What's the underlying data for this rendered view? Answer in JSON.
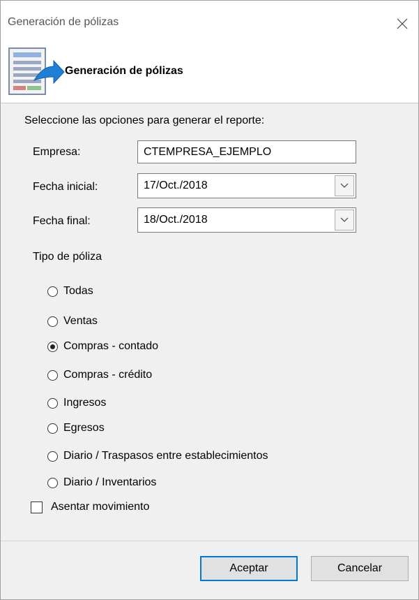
{
  "window": {
    "title": "Generación de pólizas"
  },
  "header": {
    "title": "Generación de pólizas"
  },
  "form": {
    "instructions": "Seleccione las opciones para generar el reporte:",
    "empresa": {
      "label": "Empresa:",
      "value": "CTEMPRESA_EJEMPLO"
    },
    "fecha_inicial": {
      "label": "Fecha inicial:",
      "value": "17/Oct./2018"
    },
    "fecha_final": {
      "label": "Fecha final:",
      "value": "18/Oct./2018"
    },
    "tipo_poliza": {
      "label": "Tipo de póliza",
      "options": [
        "Todas",
        "Ventas",
        "Compras - contado",
        "Compras - crédito",
        "Ingresos",
        "Egresos",
        "Diario / Traspasos entre establecimientos",
        "Diario / Inventarios"
      ],
      "selected": "Compras - contado"
    },
    "asentar": {
      "label": "Asentar movimiento",
      "checked": false
    }
  },
  "buttons": {
    "accept": "Aceptar",
    "cancel": "Cancelar"
  },
  "icons": {
    "close": "close-icon",
    "header": "report-arrow-icon",
    "dropdown": "chevron-down-icon"
  },
  "colors": {
    "accent": "#0078d7",
    "panel": "#f0f0f0"
  }
}
